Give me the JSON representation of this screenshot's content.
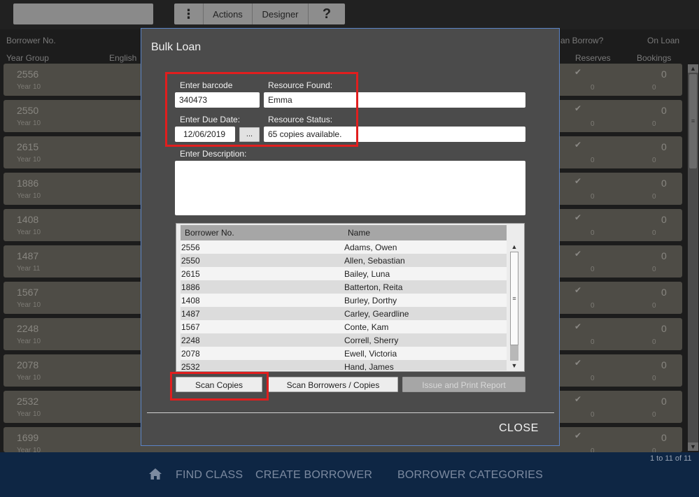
{
  "topbar": {
    "menu": {
      "actions": "Actions",
      "designer": "Designer",
      "help": "?"
    }
  },
  "background": {
    "headers": {
      "borrower_no": "Borrower No.",
      "year_group": "Year Group",
      "english": "English",
      "can_borrow": "an Borrow?",
      "on_loan": "On Loan",
      "reserves": "Reserves",
      "bookings": "Bookings"
    },
    "rows": [
      {
        "no": "2556",
        "year": "Year 10",
        "tick": "✔",
        "onloan": "0",
        "reserves": "0",
        "bookings": "0"
      },
      {
        "no": "2550",
        "year": "Year 10",
        "tick": "✔",
        "onloan": "0",
        "reserves": "0",
        "bookings": "0"
      },
      {
        "no": "2615",
        "year": "Year 10",
        "tick": "✔",
        "onloan": "0",
        "reserves": "0",
        "bookings": "0"
      },
      {
        "no": "1886",
        "year": "Year 10",
        "tick": "✔",
        "onloan": "0",
        "reserves": "0",
        "bookings": "0"
      },
      {
        "no": "1408",
        "year": "Year 10",
        "tick": "✔",
        "onloan": "0",
        "reserves": "0",
        "bookings": "0"
      },
      {
        "no": "1487",
        "year": "Year 11",
        "tick": "✔",
        "onloan": "0",
        "reserves": "0",
        "bookings": "0"
      },
      {
        "no": "1567",
        "year": "Year 10",
        "tick": "✔",
        "onloan": "0",
        "reserves": "0",
        "bookings": "0"
      },
      {
        "no": "2248",
        "year": "Year 10",
        "tick": "✔",
        "onloan": "0",
        "reserves": "0",
        "bookings": "0"
      },
      {
        "no": "2078",
        "year": "Year 10",
        "tick": "✔",
        "onloan": "0",
        "reserves": "0",
        "bookings": "0"
      },
      {
        "no": "2532",
        "year": "Year 10",
        "tick": "✔",
        "onloan": "0",
        "reserves": "0",
        "bookings": "0"
      },
      {
        "no": "1699",
        "year": "Year 10",
        "tick": "✔",
        "onloan": "0",
        "reserves": "0",
        "bookings": "0"
      }
    ],
    "pager": "1 to 11 of 11"
  },
  "bottom_nav": {
    "home_icon": "home-icon",
    "find_class": "FIND CLASS",
    "create_borrower": "CREATE BORROWER",
    "borrower_categories": "BORROWER CATEGORIES"
  },
  "dialog": {
    "title": "Bulk Loan",
    "barcode": {
      "label": "Enter barcode",
      "value": "340473"
    },
    "resource_found": {
      "label": "Resource Found:",
      "value": "Emma"
    },
    "due_date": {
      "label": "Enter Due Date:",
      "value": "12/06/2019",
      "picker": "..."
    },
    "resource_status": {
      "label": "Resource Status:",
      "value": "65  copies available."
    },
    "description": {
      "label": "Enter Description:",
      "value": ""
    },
    "grid": {
      "columns": [
        "Borrower No.",
        "Name"
      ],
      "rows": [
        [
          "2556",
          "Adams, Owen"
        ],
        [
          "2550",
          "Allen, Sebastian"
        ],
        [
          "2615",
          "Bailey, Luna"
        ],
        [
          "1886",
          "Batterton, Reita"
        ],
        [
          "1408",
          "Burley, Dorthy"
        ],
        [
          "1487",
          "Carley, Geardline"
        ],
        [
          "1567",
          "Conte, Kam"
        ],
        [
          "2248",
          "Correll, Sherry"
        ],
        [
          "2078",
          "Ewell, Victoria"
        ],
        [
          "2532",
          "Hand, James"
        ]
      ]
    },
    "buttons": {
      "scan_copies": "Scan Copies",
      "scan_borrowers": "Scan Borrowers / Copies",
      "issue_print": "Issue and Print Report"
    },
    "close": "CLOSE"
  },
  "colors": {
    "highlight": "#e11e1e",
    "dialog_border": "#5b84c7",
    "nav_background": "#0e2644"
  }
}
